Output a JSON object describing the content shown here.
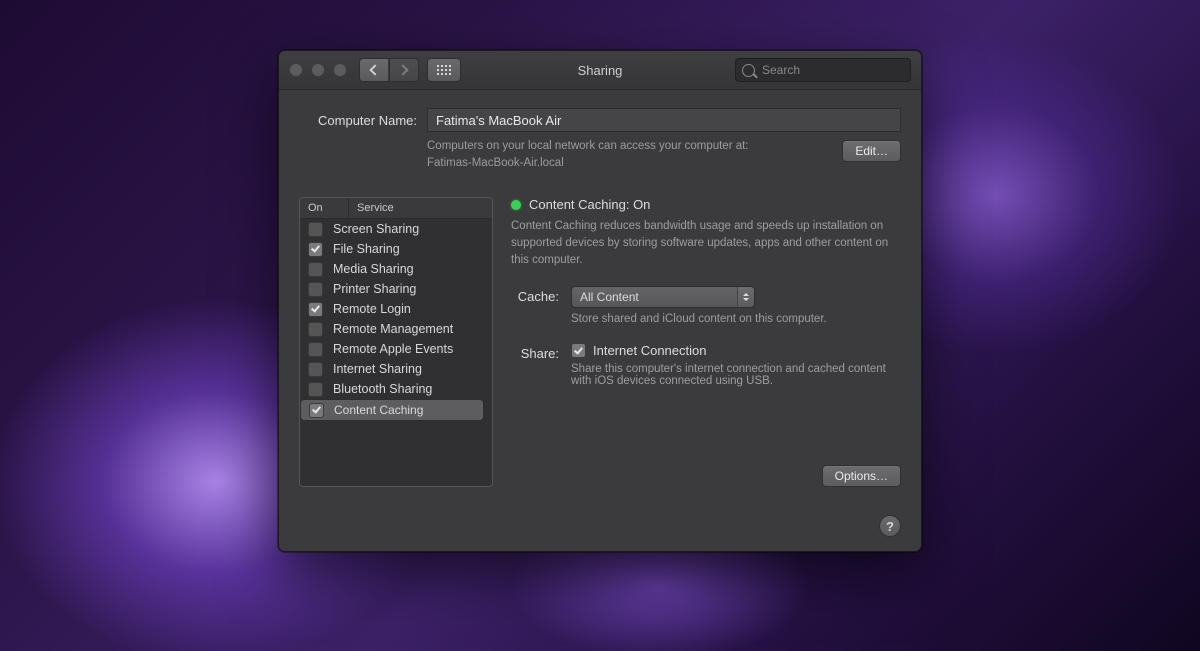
{
  "titlebar": {
    "title": "Sharing",
    "search_placeholder": "Search"
  },
  "computer": {
    "label": "Computer Name:",
    "name": "Fatima's MacBook Air",
    "note_line1": "Computers on your local network can access your computer at:",
    "note_line2": "Fatimas-MacBook-Air.local",
    "edit_label": "Edit…"
  },
  "services": {
    "header_on": "On",
    "header_service": "Service",
    "items": [
      {
        "on": false,
        "label": "Screen Sharing"
      },
      {
        "on": true,
        "label": "File Sharing"
      },
      {
        "on": false,
        "label": "Media Sharing"
      },
      {
        "on": false,
        "label": "Printer Sharing"
      },
      {
        "on": true,
        "label": "Remote Login"
      },
      {
        "on": false,
        "label": "Remote Management"
      },
      {
        "on": false,
        "label": "Remote Apple Events"
      },
      {
        "on": false,
        "label": "Internet Sharing"
      },
      {
        "on": false,
        "label": "Bluetooth Sharing"
      },
      {
        "on": true,
        "label": "Content Caching"
      }
    ],
    "selected_index": 9
  },
  "detail": {
    "status": "Content Caching: On",
    "description": "Content Caching reduces bandwidth usage and speeds up installation on supported devices by storing software updates, apps and other content on this computer.",
    "cache_label": "Cache:",
    "cache_value": "All Content",
    "cache_hint": "Store shared and iCloud content on this computer.",
    "share_label": "Share:",
    "share_checkbox_label": "Internet Connection",
    "share_hint": "Share this computer's internet connection and cached content with iOS devices connected using USB.",
    "options_label": "Options…"
  },
  "help_label": "?"
}
